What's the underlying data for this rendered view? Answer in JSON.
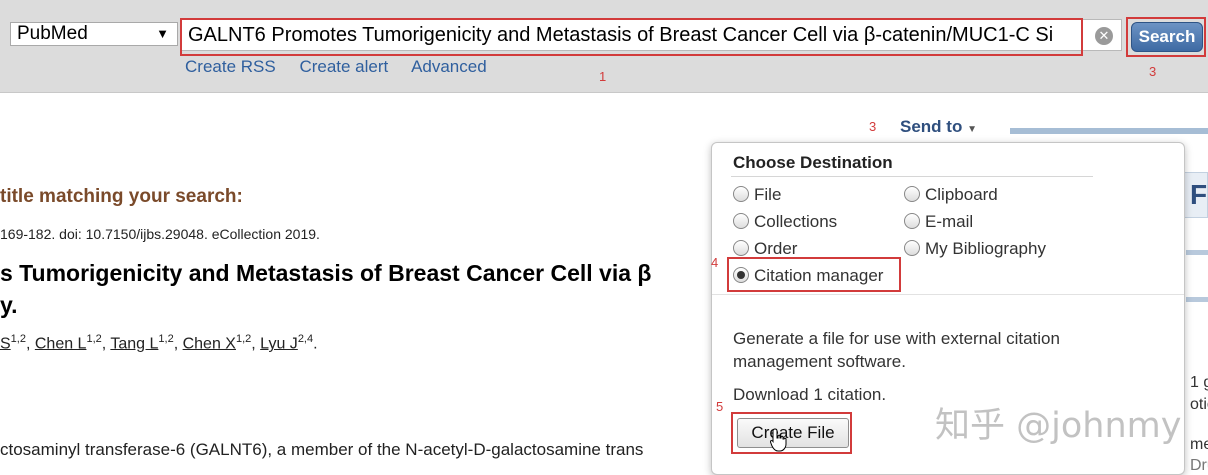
{
  "search_bar": {
    "database": "PubMed",
    "query": "GALNT6 Promotes Tumorigenicity and Metastasis of Breast Cancer Cell via β-catenin/MUC1-C Si",
    "search_label": "Search",
    "links": [
      "Create RSS",
      "Create alert",
      "Advanced"
    ]
  },
  "annotations": {
    "n1": "1",
    "n3a": "3",
    "n3b": "3",
    "n4": "4",
    "n5": "5"
  },
  "send_to": {
    "label": "Send to"
  },
  "article": {
    "match_heading": "title matching your search:",
    "citation": "169-182. doi: 10.7150/ijbs.29048. eCollection 2019.",
    "title_line1": "s Tumorigenicity and Metastasis of Breast Cancer Cell via β",
    "title_line2": "y.",
    "authors": [
      {
        "name": "S",
        "sup": "1,2"
      },
      {
        "name": "Chen L",
        "sup": "1,2"
      },
      {
        "name": "Tang L",
        "sup": "1,2"
      },
      {
        "name": "Chen X",
        "sup": "1,2"
      },
      {
        "name": "Lyu J",
        "sup": "2,4"
      }
    ],
    "abstract_start": "ctosaminyl transferase-6 (GALNT6), a member of the N-acetyl-D-galactosamine trans"
  },
  "popup": {
    "title": "Choose Destination",
    "options_left": [
      "File",
      "Collections",
      "Order",
      "Citation manager"
    ],
    "options_right": [
      "Clipboard",
      "E-mail",
      "My Bibliography"
    ],
    "selected": "Citation manager",
    "description": "Generate a file for use with external citation management software.",
    "download_count": "Download 1 citation.",
    "create_label": "Create File"
  },
  "sidebar": {
    "letter": "F",
    "t1": "1 g",
    "t2": "otic",
    "t3": "me",
    "t4": "Dru"
  },
  "watermark": "知乎 @johnmy",
  "colors": {
    "annotation_red": "#d23b3b",
    "link_blue": "#2f5f9e",
    "button_blue": "#3e6aa3"
  }
}
